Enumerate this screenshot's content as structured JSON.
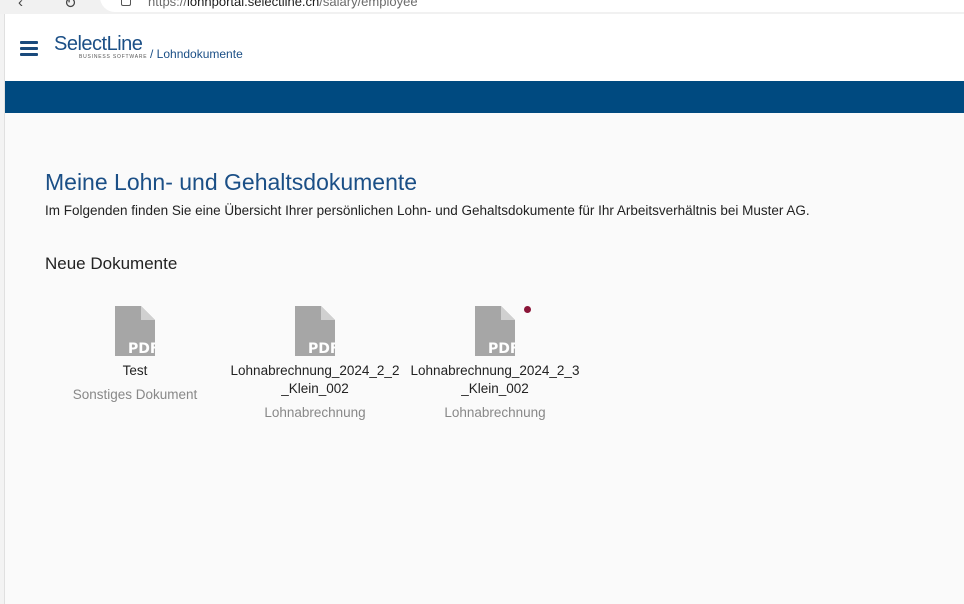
{
  "browser": {
    "url_prefix": "https://",
    "url_host": "lohnportal.selectline.ch",
    "url_path": "/salary/employee",
    "back_glyph": "‹",
    "reload_glyph": "↻"
  },
  "header": {
    "logo_brand_a": "Select",
    "logo_brand_b": "Line",
    "logo_sub": "BUSINESS SOFTWARE",
    "breadcrumb": "/ Lohndokumente"
  },
  "colors": {
    "primary": "#1b4f86",
    "bar": "#004a80",
    "new_indicator": "#8a1538",
    "pdf_icon": "#a6a6a6"
  },
  "page": {
    "title": "Meine Lohn- und Gehaltsdokumente",
    "intro": "Im Folgenden finden Sie eine Übersicht Ihrer persönlichen Lohn- und Gehaltsdokumente für Ihr Arbeitsverhältnis bei Muster AG.",
    "section_title": "Neue Dokumente"
  },
  "documents": [
    {
      "name": "Test",
      "type": "Sonstiges Dokument",
      "icon": "pdf-icon",
      "is_new": false
    },
    {
      "name": "Lohnabrechnung_2024_2_2_Klein_002",
      "type": "Lohnabrechnung",
      "icon": "pdf-icon",
      "is_new": false
    },
    {
      "name": "Lohnabrechnung_2024_2_3_Klein_002",
      "type": "Lohnabrechnung",
      "icon": "pdf-icon",
      "is_new": true
    }
  ],
  "pdf_label": "PDF"
}
